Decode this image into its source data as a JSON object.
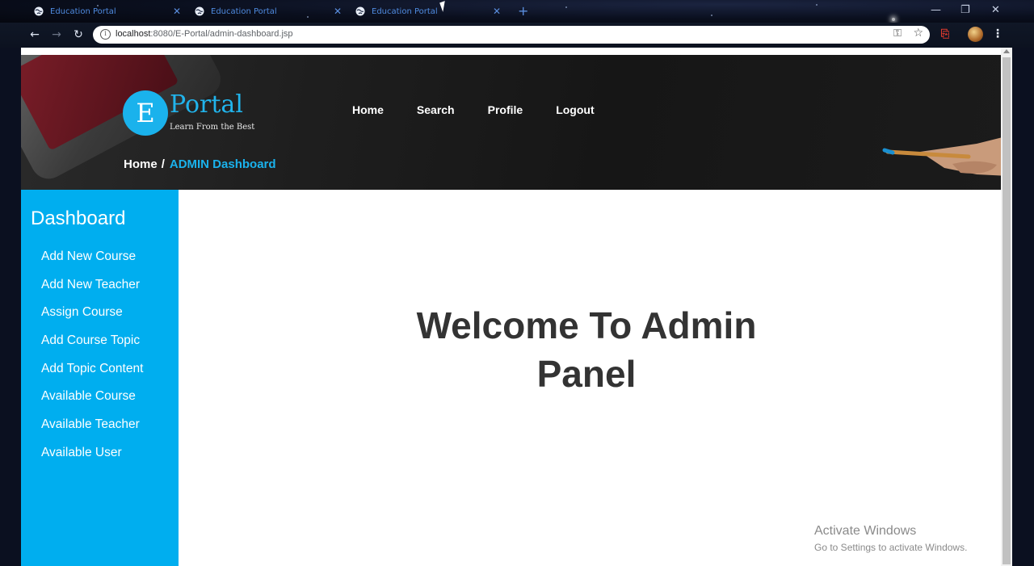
{
  "browser": {
    "tabs": [
      {
        "title": "Education Portal"
      },
      {
        "title": "Education Portal"
      },
      {
        "title": "Education Portal"
      }
    ],
    "address": {
      "host": "localhost",
      "path": ":8080/E-Portal/admin-dashboard.jsp"
    }
  },
  "site": {
    "logo": {
      "letter": "E",
      "name": "Portal",
      "tagline": "Learn From the Best"
    },
    "nav": [
      "Home",
      "Search",
      "Profile",
      "Logout"
    ],
    "breadcrumb": {
      "home": "Home",
      "separator": "/",
      "current": "ADMIN Dashboard"
    }
  },
  "sidebar": {
    "title": "Dashboard",
    "items": [
      "Add New Course",
      "Add New Teacher",
      "Assign Course",
      "Add Course Topic",
      "Add Topic Content",
      "Available Course",
      "Available Teacher",
      "Available User"
    ]
  },
  "main": {
    "welcome_line1": "Welcome To Admin",
    "welcome_line2": "Panel"
  },
  "watermark": {
    "line1": "Activate Windows",
    "line2": "Go to Settings to activate Windows."
  },
  "colors": {
    "accent": "#00aeef",
    "header_bg": "#1c1c1c",
    "text": "#333333"
  }
}
